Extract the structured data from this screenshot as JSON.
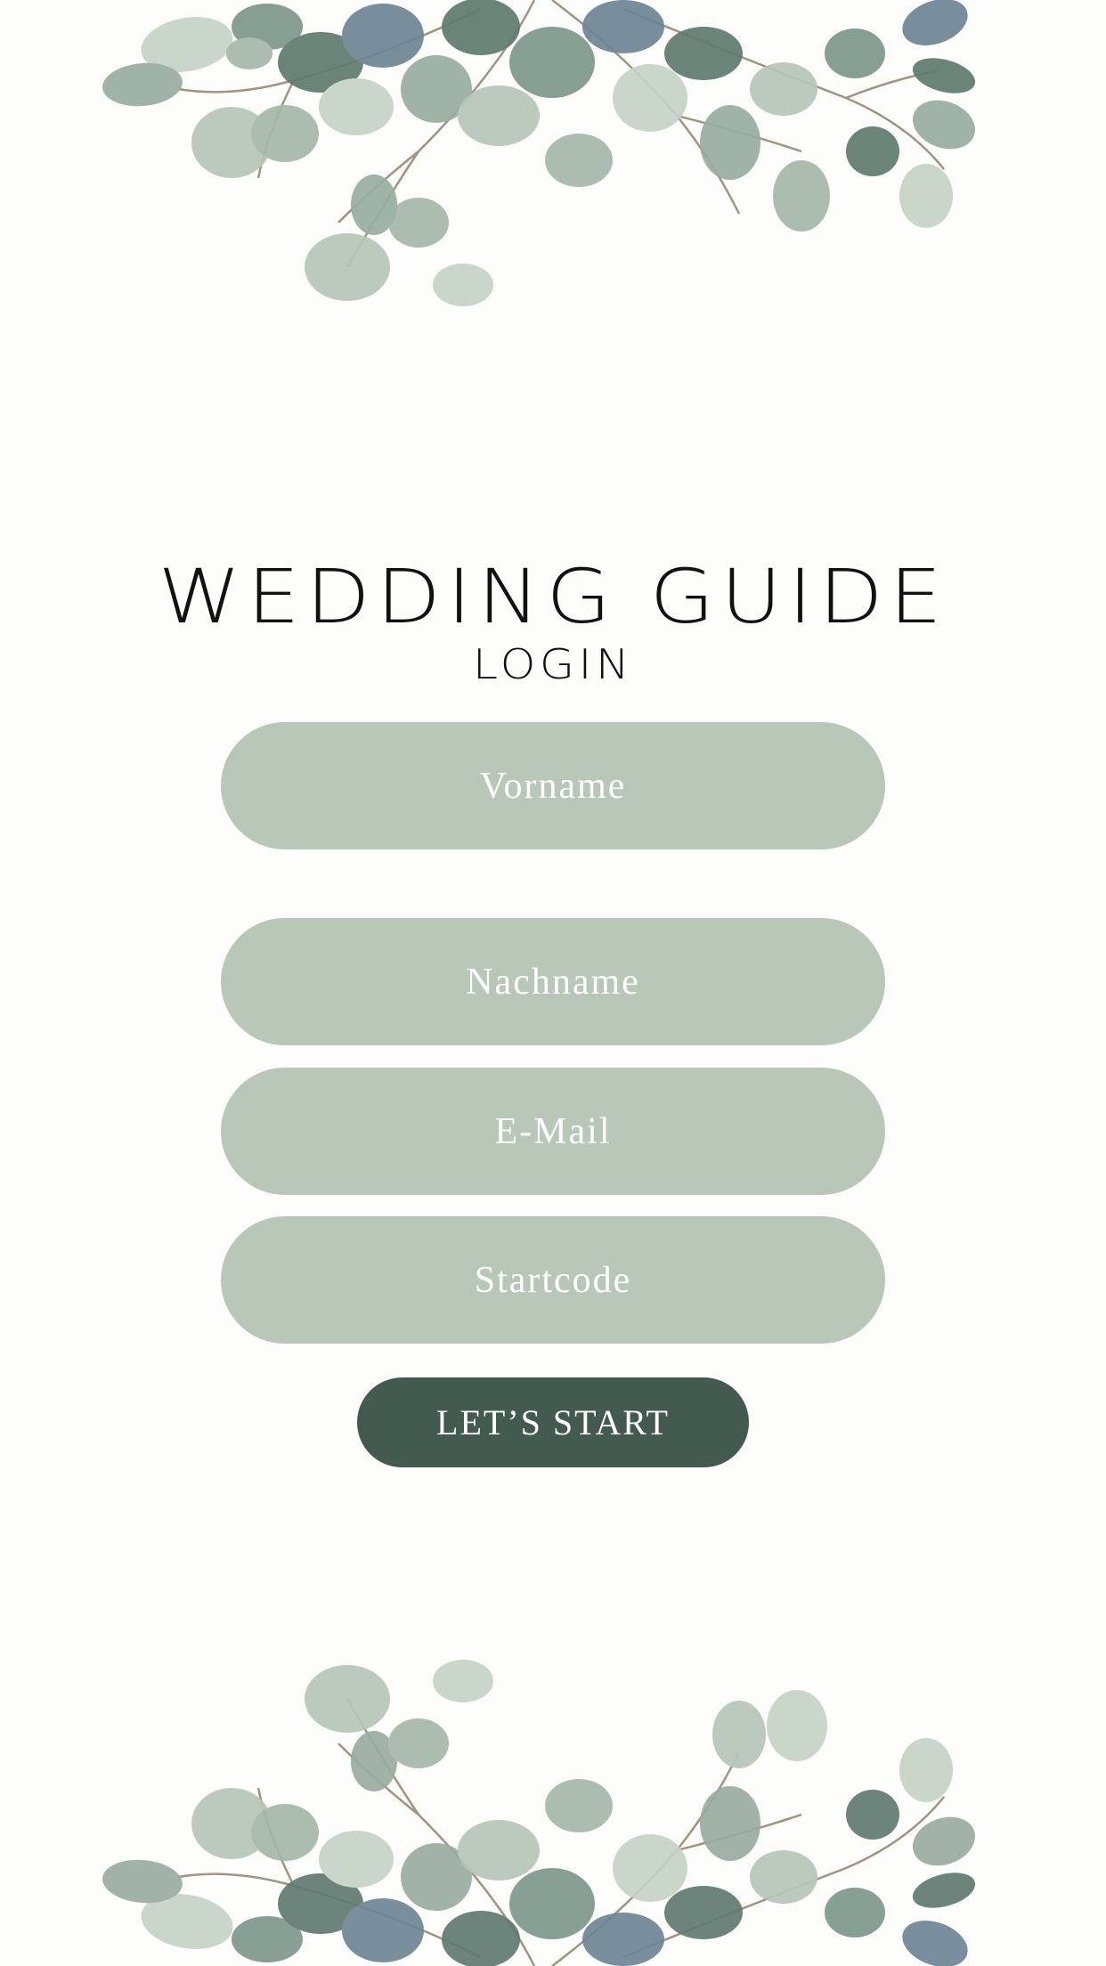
{
  "header": {
    "title": "WEDDING GUIDE",
    "subtitle": "LOGIN"
  },
  "form": {
    "first_name_placeholder": "Vorname",
    "last_name_placeholder": "Nachname",
    "email_placeholder": "E-Mail",
    "start_code_placeholder": "Startcode",
    "submit_label": "LET’S START"
  },
  "colors": {
    "background": "#fdfdfc",
    "field": "#b9c7b9",
    "button": "#425a50",
    "leaf_light": "#c5d3c5",
    "leaf_mid": "#98ad9f",
    "leaf_dark": "#5f7a70",
    "leaf_blue": "#6e8596"
  },
  "decorations": {
    "top": "eucalyptus-branches",
    "bottom": "eucalyptus-branches"
  }
}
